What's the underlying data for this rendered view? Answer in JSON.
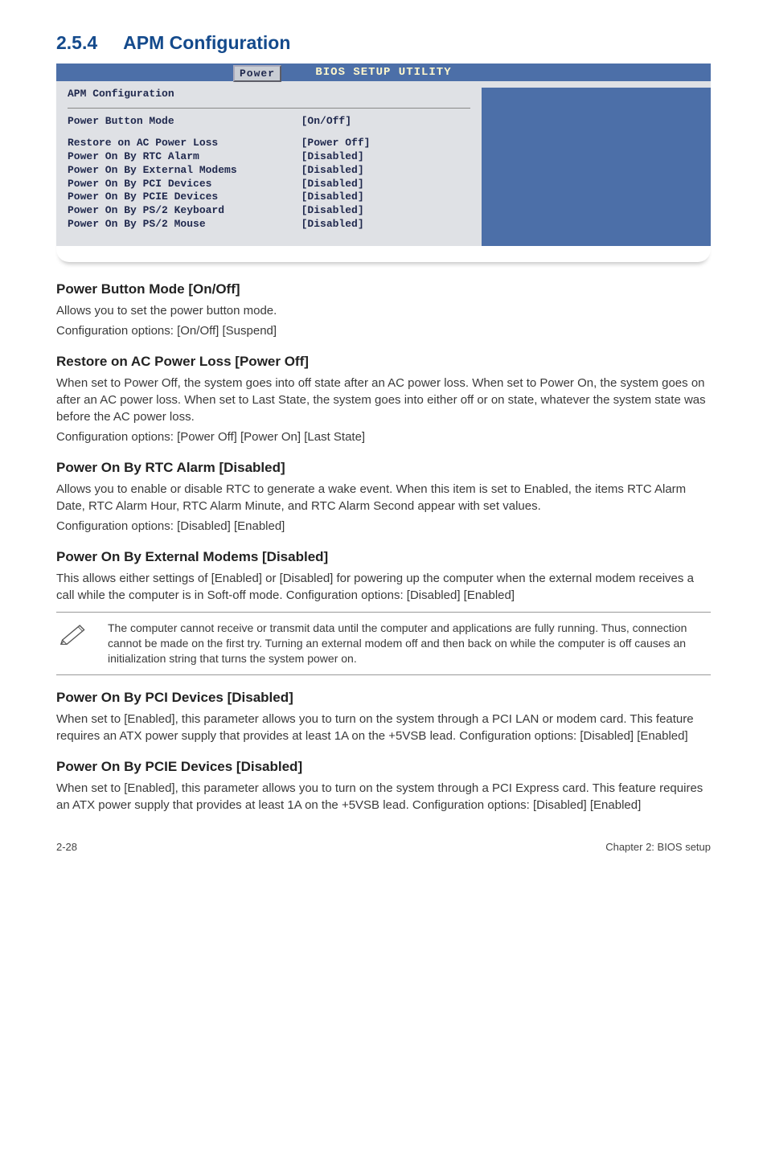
{
  "section": {
    "number": "2.5.4",
    "title": "APM Configuration"
  },
  "bios": {
    "header": "BIOS SETUP UTILITY",
    "tab": "Power",
    "subheader": "APM Configuration",
    "rows": [
      {
        "key": "Power Button Mode",
        "val": "[On/Off]"
      }
    ],
    "rows2": [
      {
        "key": "Restore on AC Power Loss",
        "val": "[Power Off]"
      },
      {
        "key": "Power On By RTC Alarm",
        "val": "[Disabled]"
      },
      {
        "key": "Power On By External Modems",
        "val": "[Disabled]"
      },
      {
        "key": "Power On By PCI Devices",
        "val": "[Disabled]"
      },
      {
        "key": "Power On By PCIE Devices",
        "val": "[Disabled]"
      },
      {
        "key": "Power On By PS/2 Keyboard",
        "val": "[Disabled]"
      },
      {
        "key": "Power On By PS/2 Mouse",
        "val": "[Disabled]"
      }
    ]
  },
  "blocks": [
    {
      "h": "Power Button Mode [On/Off]",
      "p": [
        "Allows you to set the power button mode.",
        "Configuration options: [On/Off] [Suspend]"
      ]
    },
    {
      "h": "Restore on AC Power Loss [Power Off]",
      "p": [
        "When set to Power Off, the system goes into off state after an AC power loss. When set to Power On, the system goes on after an AC power loss. When set to Last State, the system goes into either off or on state, whatever the system state was before the AC power loss.",
        "Configuration options: [Power Off] [Power On] [Last State]"
      ]
    },
    {
      "h": "Power On By RTC Alarm [Disabled]",
      "p": [
        "Allows you to enable or disable RTC to generate a wake event. When this item is set to Enabled, the items RTC Alarm Date, RTC Alarm Hour, RTC Alarm Minute, and RTC Alarm Second appear with set values.",
        "Configuration options: [Disabled] [Enabled]"
      ]
    },
    {
      "h": "Power On By External Modems [Disabled]",
      "p": [
        "This allows either settings of [Enabled] or [Disabled] for powering up the computer when the external modem receives a call while the computer is in Soft-off mode. Configuration options: [Disabled] [Enabled]"
      ]
    }
  ],
  "note": "The computer cannot receive or transmit data until the computer and applications are fully running. Thus, connection cannot be made on the first try. Turning an external modem off and then back on while the computer is off causes an initialization string that turns the system power on.",
  "blocks2": [
    {
      "h": "Power On By PCI Devices [Disabled]",
      "p": [
        "When set to [Enabled], this parameter allows you to turn on the system through a PCI LAN or modem card. This feature requires an ATX power supply that provides at least 1A on the +5VSB lead. Configuration options: [Disabled] [Enabled]"
      ]
    },
    {
      "h": "Power On By PCIE Devices [Disabled]",
      "p": [
        "When set to [Enabled], this parameter allows you to turn on the system through a PCI Express card. This feature requires an ATX power supply that provides at least 1A on the +5VSB lead.  Configuration options: [Disabled] [Enabled]"
      ]
    }
  ],
  "footer": {
    "left": "2-28",
    "right": "Chapter 2: BIOS setup"
  }
}
